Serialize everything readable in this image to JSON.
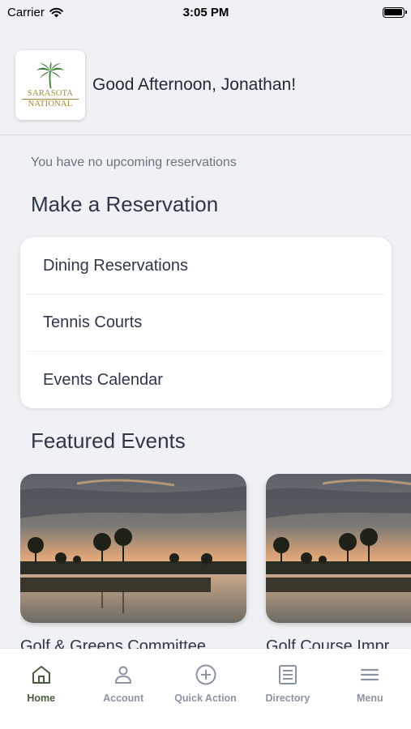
{
  "status_bar": {
    "carrier": "Carrier",
    "time": "3:05 PM"
  },
  "header": {
    "logo_line1": "SARASOTA",
    "logo_line2": "NATIONAL",
    "greeting": "Good Afternoon, Jonathan!"
  },
  "reservations": {
    "empty_message": "You have no upcoming reservations",
    "section_title": "Make a Reservation",
    "items": [
      {
        "label": "Dining Reservations"
      },
      {
        "label": "Tennis Courts"
      },
      {
        "label": "Events Calendar"
      }
    ]
  },
  "featured": {
    "section_title": "Featured Events",
    "events": [
      {
        "title": "Golf & Greens Committee"
      },
      {
        "title": "Golf Course Impr"
      }
    ]
  },
  "tab_bar": {
    "tabs": [
      {
        "label": "Home",
        "icon": "home-icon",
        "active": true
      },
      {
        "label": "Account",
        "icon": "person-icon"
      },
      {
        "label": "Quick Action",
        "icon": "plus-circle-icon"
      },
      {
        "label": "Directory",
        "icon": "directory-icon"
      },
      {
        "label": "Menu",
        "icon": "menu-icon"
      }
    ]
  },
  "colors": {
    "active_tab": "#4a5a3f",
    "inactive_tab": "#8a94a3",
    "logo_gold": "#a08a3c",
    "logo_green": "#3f7a3a"
  }
}
